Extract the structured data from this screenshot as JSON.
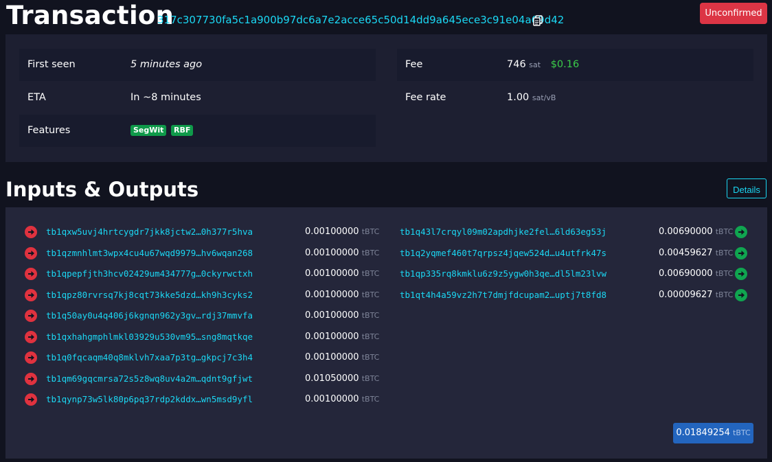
{
  "header": {
    "title": "Transaction",
    "txid": "317c307730fa5c1a900b97dc6a7e2acce65c50d14dd9a645ece3c91e04a69d42",
    "status": "Unconfirmed"
  },
  "summary": {
    "first_seen_label": "First seen",
    "first_seen_value": "5 minutes ago",
    "eta_label": "ETA",
    "eta_value": "In ~8 minutes",
    "features_label": "Features",
    "features": [
      "SegWit",
      "RBF"
    ],
    "fee_label": "Fee",
    "fee_value": "746",
    "fee_unit": "sat",
    "fee_usd": "$0.16",
    "fee_rate_label": "Fee rate",
    "fee_rate_value": "1.00",
    "fee_rate_unit": "sat/vB"
  },
  "io": {
    "section_title": "Inputs & Outputs",
    "details_label": "Details",
    "unit": "tBTC",
    "inputs": [
      {
        "address": "tb1qxw5uvj4hrtcygdr7jkk8jctw2…0h377r5hva",
        "amount": "0.00100000"
      },
      {
        "address": "tb1qzmnhlmt3wpx4cu4u67wqd9979…hv6wqan268",
        "amount": "0.00100000"
      },
      {
        "address": "tb1qpepfjth3hcv02429um434777g…0ckyrwctxh",
        "amount": "0.00100000"
      },
      {
        "address": "tb1qpz80rvrsq7kj8cqt73kke5dzd…kh9h3cyks2",
        "amount": "0.00100000"
      },
      {
        "address": "tb1q50ay0u4q406j6kgnqn962y3gv…rdj37mmvfa",
        "amount": "0.00100000"
      },
      {
        "address": "tb1qxhahgmphlmkl03929u530vm95…sng8mqtkqe",
        "amount": "0.00100000"
      },
      {
        "address": "tb1q0fqcaqm40q8mklvh7xaa7p3tg…gkpcj7c3h4",
        "amount": "0.00100000"
      },
      {
        "address": "tb1qm69gqcmrsa72s5z8wq8uv4a2m…qdnt9gfjwt",
        "amount": "0.01050000"
      },
      {
        "address": "tb1qynp73w5lk80p6pq37rdp2kddx…wn5msd9yfl",
        "amount": "0.00100000"
      }
    ],
    "outputs": [
      {
        "address": "tb1q43l7crqyl09m02apdhjke2fel…6ld63eg53j",
        "amount": "0.00690000"
      },
      {
        "address": "tb1q2yqmef460t7qrpsz4jqew524d…u4utfrk47s",
        "amount": "0.00459627"
      },
      {
        "address": "tb1qp335rq8kmklu6z9z5ygw0h3qe…dl5lm23lvw",
        "amount": "0.00690000"
      },
      {
        "address": "tb1qt4h4a59vz2h7t7dmjfdcupam2…uptj7t8fd8",
        "amount": "0.00009627"
      }
    ],
    "total_amount": "0.01849254"
  },
  "colors": {
    "input_icon": "#e0323f",
    "output_icon": "#10a550",
    "link": "#1bd8f4",
    "status_badge": "#dc3545",
    "total_badge": "#2365be"
  }
}
